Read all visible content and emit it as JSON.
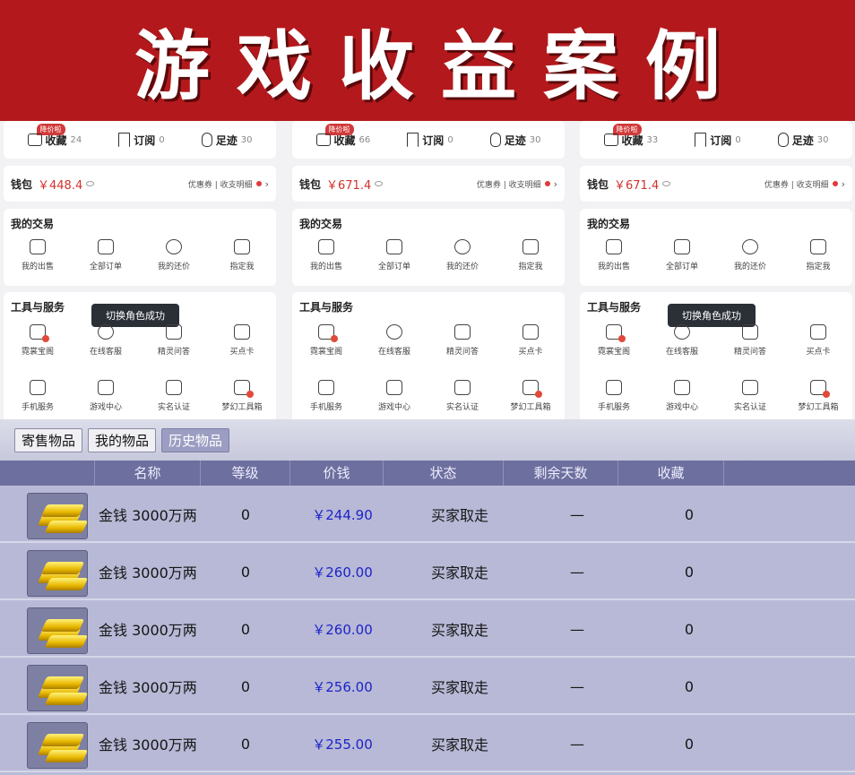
{
  "banner": {
    "title": "游戏收益案例"
  },
  "phones": [
    {
      "fav": {
        "tag": "降价啦",
        "collect": "收藏",
        "collect_count": "24",
        "subscribe": "订阅",
        "subscribe_count": "0",
        "footprint": "足迹",
        "footprint_count": "30"
      },
      "wallet": {
        "label": "钱包",
        "amount": "￥448.4",
        "right": "优惠券 | 收支明细"
      },
      "trade": {
        "title": "我的交易",
        "items": [
          "我的出售",
          "全部订单",
          "我的还价",
          "指定我"
        ]
      },
      "tools": {
        "title": "工具与服务",
        "toast": "切换角色成功",
        "row1": [
          "霓裳宝阁",
          "在线客服",
          "精灵问答",
          "买点卡"
        ],
        "row2": [
          "手机服务",
          "游戏中心",
          "实名认证",
          "梦幻工具箱"
        ]
      }
    },
    {
      "fav": {
        "tag": "降价啦",
        "collect": "收藏",
        "collect_count": "66",
        "subscribe": "订阅",
        "subscribe_count": "0",
        "footprint": "足迹",
        "footprint_count": "30"
      },
      "wallet": {
        "label": "钱包",
        "amount": "￥671.4",
        "right": "优惠券 | 收支明细"
      },
      "trade": {
        "title": "我的交易",
        "items": [
          "我的出售",
          "全部订单",
          "我的还价",
          "指定我"
        ]
      },
      "tools": {
        "title": "工具与服务",
        "toast": "",
        "row1": [
          "霓裳宝阁",
          "在线客服",
          "精灵问答",
          "买点卡"
        ],
        "row2": [
          "手机服务",
          "游戏中心",
          "实名认证",
          "梦幻工具箱"
        ]
      }
    },
    {
      "fav": {
        "tag": "降价啦",
        "collect": "收藏",
        "collect_count": "33",
        "subscribe": "订阅",
        "subscribe_count": "0",
        "footprint": "足迹",
        "footprint_count": "30"
      },
      "wallet": {
        "label": "钱包",
        "amount": "￥671.4",
        "right": "优惠券 | 收支明细"
      },
      "trade": {
        "title": "我的交易",
        "items": [
          "我的出售",
          "全部订单",
          "我的还价",
          "指定我"
        ]
      },
      "tools": {
        "title": "工具与服务",
        "toast": "切换角色成功",
        "row1": [
          "霓裳宝阁",
          "在线客服",
          "精灵问答",
          "买点卡"
        ],
        "row2": [
          "手机服务",
          "游戏中心",
          "实名认证",
          "梦幻工具箱"
        ]
      }
    }
  ],
  "game": {
    "tabs": [
      "寄售物品",
      "我的物品",
      "历史物品"
    ],
    "active_tab": "历史物品",
    "headers": [
      "名称",
      "等级",
      "价钱",
      "状态",
      "剩余天数",
      "收藏"
    ],
    "rows": [
      {
        "name": "金钱 3000万两",
        "level": "0",
        "price": "￥244.90",
        "status": "买家取走",
        "days": "—",
        "fav": "0"
      },
      {
        "name": "金钱 3000万两",
        "level": "0",
        "price": "￥260.00",
        "status": "买家取走",
        "days": "—",
        "fav": "0"
      },
      {
        "name": "金钱 3000万两",
        "level": "0",
        "price": "￥260.00",
        "status": "买家取走",
        "days": "—",
        "fav": "0"
      },
      {
        "name": "金钱 3000万两",
        "level": "0",
        "price": "￥256.00",
        "status": "买家取走",
        "days": "—",
        "fav": "0"
      },
      {
        "name": "金钱 3000万两",
        "level": "0",
        "price": "￥255.00",
        "status": "买家取走",
        "days": "—",
        "fav": "0"
      }
    ]
  }
}
